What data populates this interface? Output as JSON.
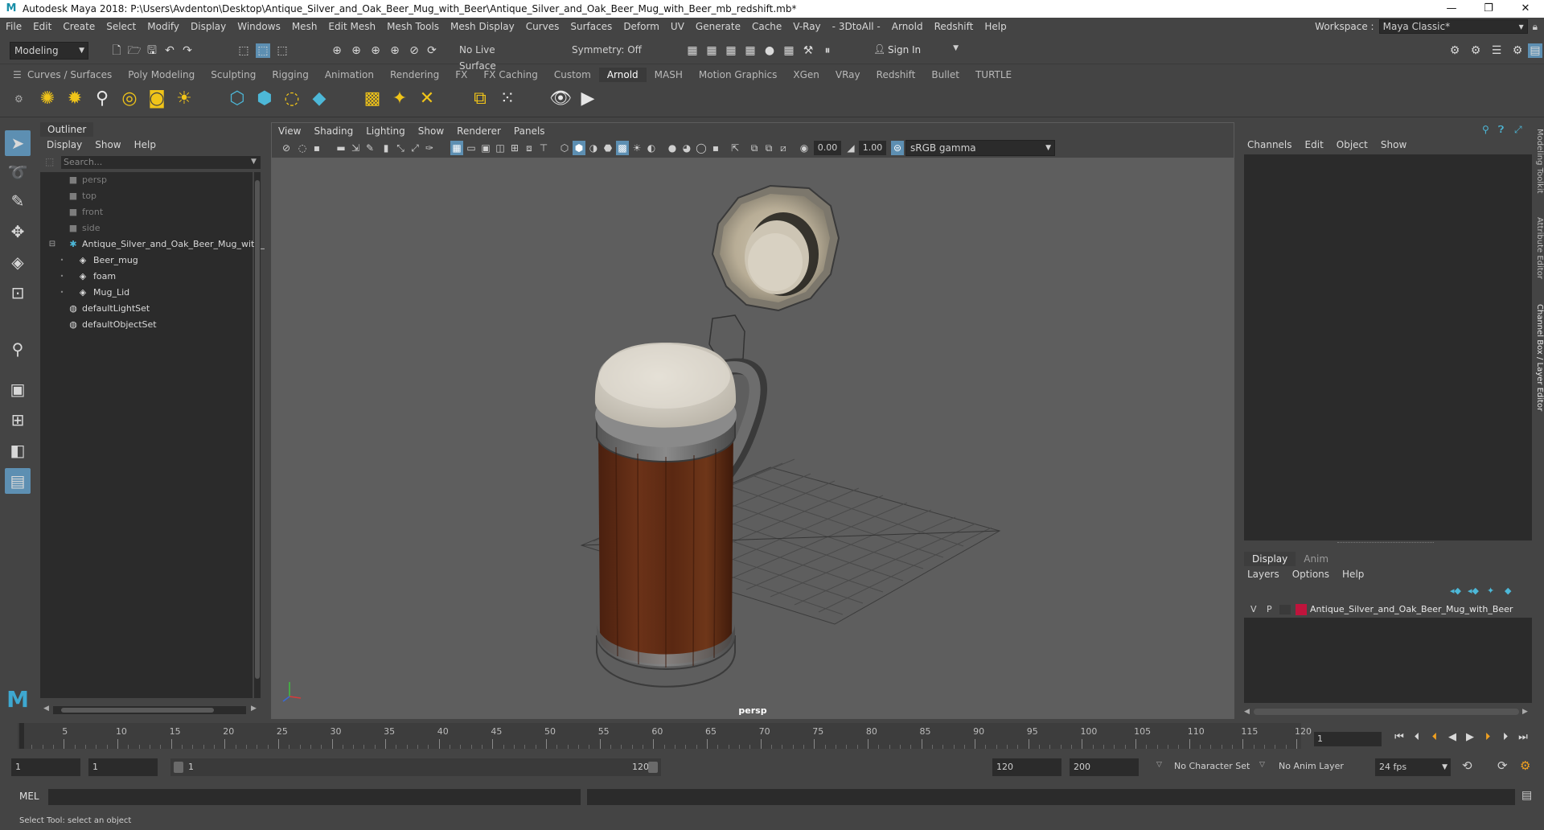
{
  "window": {
    "title": "Autodesk Maya 2018: P:\\Users\\Avdenton\\Desktop\\Antique_Silver_and_Oak_Beer_Mug_with_Beer\\Antique_Silver_and_Oak_Beer_Mug_with_Beer_mb_redshift.mb*",
    "minimize": "—",
    "maximize": "❐",
    "close": "✕"
  },
  "menubar": {
    "items": [
      "File",
      "Edit",
      "Create",
      "Select",
      "Modify",
      "Display",
      "Windows",
      "Mesh",
      "Edit Mesh",
      "Mesh Tools",
      "Mesh Display",
      "Curves",
      "Surfaces",
      "Deform",
      "UV",
      "Generate",
      "Cache",
      "V-Ray",
      "- 3DtoAll -",
      "Arnold",
      "Redshift",
      "Help"
    ],
    "workspace_label": "Workspace :",
    "workspace_value": "Maya Classic*"
  },
  "statusline": {
    "mode": "Modeling",
    "live_surface": "No Live Surface",
    "symmetry": "Symmetry: Off",
    "sign_in": "Sign In"
  },
  "shelf": {
    "tabs": [
      "Curves / Surfaces",
      "Poly Modeling",
      "Sculpting",
      "Rigging",
      "Animation",
      "Rendering",
      "FX",
      "FX Caching",
      "Custom",
      "Arnold",
      "MASH",
      "Motion Graphics",
      "XGen",
      "VRay",
      "Redshift",
      "Bullet",
      "TURTLE"
    ],
    "active_tab": "Arnold"
  },
  "outliner": {
    "title": "Outliner",
    "menus": [
      "Display",
      "Show",
      "Help"
    ],
    "search_placeholder": "Search...",
    "items": [
      {
        "label": "persp",
        "icon": "camera-icon",
        "dim": true
      },
      {
        "label": "top",
        "icon": "camera-icon",
        "dim": true
      },
      {
        "label": "front",
        "icon": "camera-icon",
        "dim": true
      },
      {
        "label": "side",
        "icon": "camera-icon",
        "dim": true
      },
      {
        "label": "Antique_Silver_and_Oak_Beer_Mug_with_",
        "icon": "group-icon",
        "dim": false
      },
      {
        "label": "Beer_mug",
        "icon": "mesh-icon",
        "dim": false
      },
      {
        "label": "foam",
        "icon": "mesh-icon",
        "dim": false
      },
      {
        "label": "Mug_Lid",
        "icon": "mesh-icon",
        "dim": false
      },
      {
        "label": "defaultLightSet",
        "icon": "set-icon",
        "dim": false
      },
      {
        "label": "defaultObjectSet",
        "icon": "set-icon",
        "dim": false
      }
    ]
  },
  "viewport": {
    "menus": [
      "View",
      "Shading",
      "Lighting",
      "Show",
      "Renderer",
      "Panels"
    ],
    "exposure": "0.00",
    "gamma": "1.00",
    "color_space": "sRGB gamma",
    "camera_label": "persp"
  },
  "channelbox": {
    "menus": [
      "Channels",
      "Edit",
      "Object",
      "Show"
    ],
    "side_tabs": [
      "Modeling Toolkit",
      "Attribute Editor",
      "Channel Box / Layer Editor"
    ],
    "layer_tabs": [
      "Display",
      "Anim"
    ],
    "layer_menus": [
      "Layers",
      "Options",
      "Help"
    ],
    "layer": {
      "v": "V",
      "p": "P",
      "name": "Antique_Silver_and_Oak_Beer_Mug_with_Beer",
      "color": "#c0143c"
    }
  },
  "timeline": {
    "ticks": [
      "1",
      "5",
      "10",
      "15",
      "20",
      "25",
      "30",
      "35",
      "40",
      "45",
      "50",
      "55",
      "60",
      "65",
      "70",
      "75",
      "80",
      "85",
      "90",
      "95",
      "100",
      "105",
      "110",
      "115",
      "120"
    ],
    "current_frame": "1"
  },
  "range": {
    "start": "1",
    "playback_start": "1",
    "slider_start": "1",
    "slider_end": "120",
    "playback_end": "120",
    "end": "200",
    "character_set": "No Character Set",
    "anim_layer": "No Anim Layer",
    "fps": "24 fps"
  },
  "cmdline": {
    "label": "MEL"
  },
  "helpline": {
    "text": "Select Tool: select an object"
  }
}
